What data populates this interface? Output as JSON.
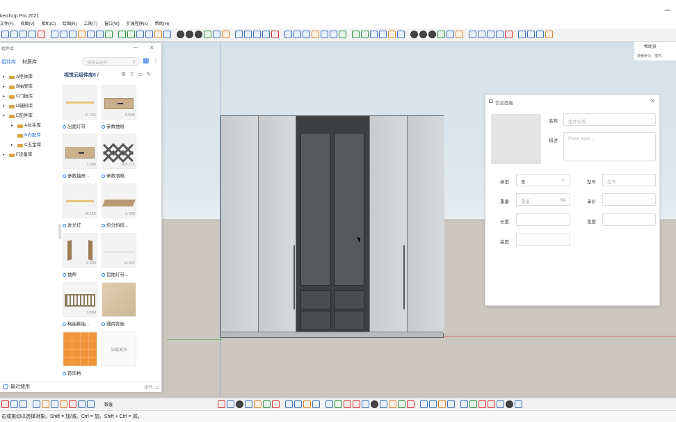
{
  "window": {
    "title": "ketchUp Pro 2021"
  },
  "menu": [
    "文件(F)",
    "视图(V)",
    "相机(C)",
    "绘图(R)",
    "工具(T)",
    "窗口(W)",
    "扩展程序(x)",
    "帮助(H)"
  ],
  "library": {
    "title": "组件库",
    "tabs": [
      "组件库",
      "材质库"
    ],
    "active_tab": 0,
    "search_placeholder": "搜索云组件",
    "tree": [
      {
        "label": "A柜体库",
        "level": 1,
        "expanded": false
      },
      {
        "label": "B抽屉库",
        "level": 1,
        "expanded": false
      },
      {
        "label": "C门板库",
        "level": 1,
        "expanded": false
      },
      {
        "label": "D辅料库",
        "level": 1,
        "expanded": false
      },
      {
        "label": "E配件库",
        "level": 1,
        "expanded": true
      },
      {
        "label": "A拉手库",
        "level": 2,
        "expanded": false
      },
      {
        "label": "B内配库",
        "level": 2,
        "selected": true
      },
      {
        "label": "C五金库",
        "level": 2,
        "expanded": false
      },
      {
        "label": "F设备库",
        "level": 1,
        "expanded": false
      }
    ],
    "breadcrumb": "视觉云组件库6 /",
    "cards": [
      {
        "name": "出面灯带",
        "size": "47.23K",
        "thumb": "strip"
      },
      {
        "name": "参数抽屉",
        "size": "8.55M",
        "thumb": "drawer"
      },
      {
        "name": "参数抽屉...",
        "size": "7.54M",
        "thumb": "drawer"
      },
      {
        "name": "参数酒格",
        "size": "403.71K",
        "thumb": "lattice"
      },
      {
        "name": "发光灯",
        "size": "36.15K",
        "thumb": "strip"
      },
      {
        "name": "均分斜层...",
        "size": "3.76M",
        "thumb": "shelf"
      },
      {
        "name": "抽帮",
        "size": "6.32M",
        "thumb": "sides"
      },
      {
        "name": "铝抽灯带...",
        "size": "46.48K",
        "thumb": "line"
      },
      {
        "name": "格抽裤抽...",
        "size": "7.89M",
        "thumb": "rack"
      },
      {
        "name": "通用背板",
        "size": "",
        "thumb": "board"
      },
      {
        "name": "首饰格",
        "size": "",
        "thumb": "grid"
      },
      {
        "name": "",
        "size": "",
        "thumb": "more",
        "more_label": "加载更多"
      }
    ],
    "footer": {
      "recent": "最近使用",
      "count": "组件: 11"
    }
  },
  "tray": {
    "title": "帮助员",
    "hint": "搜索命令、插件、"
  },
  "info_panel": {
    "title": "信息面板",
    "fields": {
      "name": {
        "label": "名称",
        "placeholder": "组件名称"
      },
      "desc": {
        "label": "描述",
        "placeholder": "Place input..."
      },
      "type": {
        "label": "类型",
        "value": "无"
      },
      "model": {
        "label": "型号",
        "placeholder": "型号"
      },
      "weight": {
        "label": "重量",
        "placeholder": "重量",
        "unit": "kg"
      },
      "price": {
        "label": "单价",
        "placeholder": ""
      },
      "length": {
        "label": "长度",
        "placeholder": ""
      },
      "depth": {
        "label": "宽度",
        "placeholder": ""
      },
      "height": {
        "label": "高度",
        "placeholder": ""
      }
    }
  },
  "bottom": {
    "label": "数值"
  },
  "status": {
    "message": "击或拖动以选择对象。Shift = 加/减。Ctrl = 加。Shift + Ctrl = 减。"
  },
  "colors": {
    "accent": "#2b78e4",
    "wardrobe_light": "#cfd2d4",
    "wardrobe_dark": "#3d3f41",
    "ground": "#cbc6c0",
    "sky": "#d5e1e8"
  }
}
